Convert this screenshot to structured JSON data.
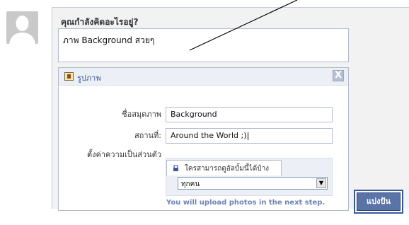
{
  "composer": {
    "title": "คุณกำลังคิดอะไรอยู่?",
    "status_value": "ภาพ Background สวยๆ"
  },
  "photo_panel": {
    "title": "รูปภาพ",
    "close_label": "X",
    "icon": "photo-icon",
    "album_label": "ชื่อสมุดภาพ",
    "album_value": "Background",
    "location_label": "สถานที่:",
    "location_value": "Around the World ;)",
    "privacy_label": "ตั้งค่าความเป็นส่วนตัว",
    "privacy_tab_label": "ใครสามารถดูอัลบั้มนี้ได้บ้าง",
    "privacy_selected": "ทุกคน",
    "upload_note": "You will upload photos in the next step."
  },
  "share_button": {
    "label": "แบ่งปัน"
  },
  "colors": {
    "accent": "#3b5998",
    "button_fill": "#5b74a8",
    "panel_bg": "#f2f2f2",
    "header_bg": "#eceff5"
  }
}
